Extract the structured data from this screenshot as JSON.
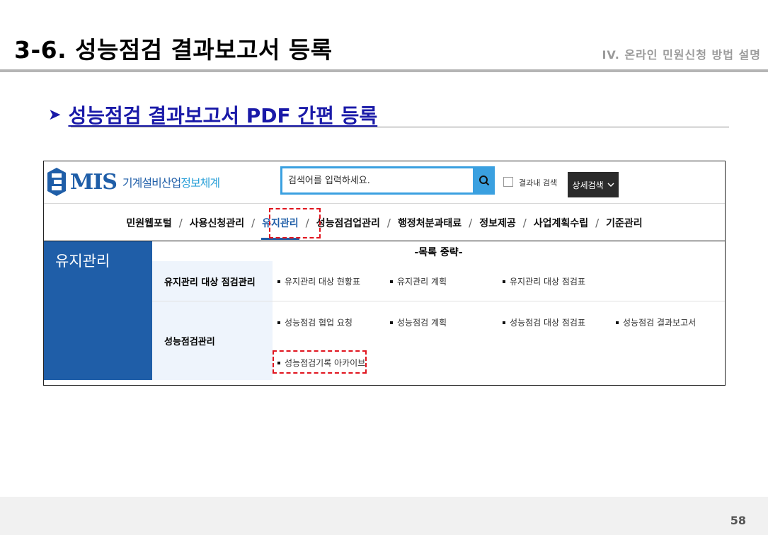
{
  "slide": {
    "title": "3-6. 성능점검 결과보고서 등록",
    "section": "IV. 온라인 민원신청 방법 설명",
    "subheading": "성능점검 결과보고서 PDF 간편 등록",
    "page_number": "58"
  },
  "app": {
    "logo_text": "MIS",
    "logo_sub_a": "기계설비산업",
    "logo_sub_b": "정보체계",
    "search_placeholder": "검색어를 입력하세요.",
    "search_in_results_label": "결과내 검색",
    "advanced_search_label": "상세검색",
    "nav": [
      "민원웹포털",
      "사용신청관리",
      "유지관리",
      "성능점검업관리",
      "행정처분과태료",
      "정보제공",
      "사업계획수립",
      "기준관리"
    ],
    "active_nav_index": 2,
    "sidebar_title": "유지관리",
    "menu_title": "-목록 중략-",
    "categories": [
      {
        "label": "유지관리 대상 점검관리",
        "links": [
          "유지관리 대상 현황표",
          "유지관리 계획",
          "유지관리 대상 점검표"
        ]
      },
      {
        "label": "성능점검관리",
        "links": [
          "성능점검 협업 요청",
          "성능점검 계획",
          "성능점검 대상 점검표",
          "성능점검 결과보고서",
          "성능점검기록 아카이브"
        ]
      }
    ]
  },
  "colors": {
    "brand_blue": "#1f5ea8",
    "search_blue": "#3aa0e0",
    "subheading_blue": "#1a1aa8",
    "highlight_red": "#e0141e"
  }
}
